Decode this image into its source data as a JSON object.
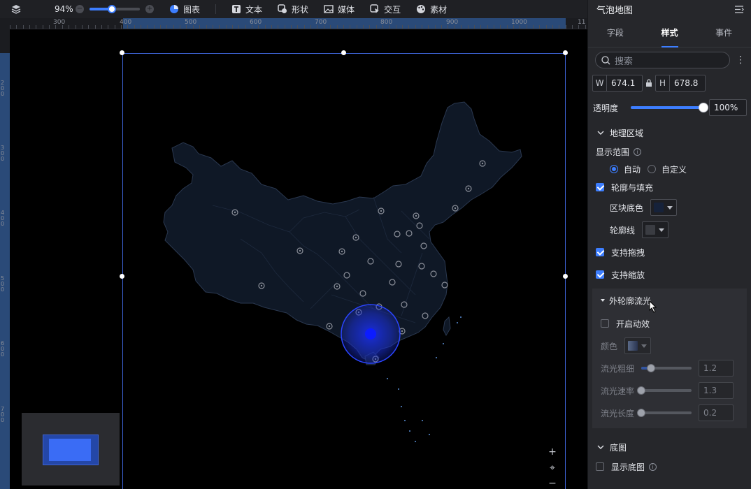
{
  "toolbar": {
    "zoom": "94%",
    "zoom_fraction": 0.45,
    "items": [
      {
        "label": "图表",
        "icon": "chart-pie-icon"
      },
      {
        "label": "文本",
        "icon": "text-icon"
      },
      {
        "label": "形状",
        "icon": "shape-icon"
      },
      {
        "label": "媒体",
        "icon": "image-icon"
      },
      {
        "label": "交互",
        "icon": "interaction-icon"
      },
      {
        "label": "素材",
        "icon": "palette-icon"
      }
    ]
  },
  "ruler": {
    "h_labels": [
      "300",
      "400",
      "500",
      "600",
      "700",
      "800",
      "900",
      "1000",
      "11"
    ],
    "v_labels": [
      "2\n0\n0",
      "3\n0\n0",
      "4\n0\n0",
      "5\n0\n0",
      "6\n0\n0",
      "7\n0\n0"
    ]
  },
  "map_ctrl": {
    "zoom_in": "+",
    "locate": "⌖",
    "zoom_out": "−"
  },
  "panel": {
    "title": "气泡地图",
    "tabs": [
      "字段",
      "样式",
      "事件"
    ],
    "active_tab": "样式",
    "search_placeholder": "搜索",
    "kebab": "⋮",
    "w_label": "W",
    "w_value": "674.1",
    "h_label": "H",
    "h_value": "678.8",
    "opacity_label": "透明度",
    "opacity_value": "100%",
    "opacity_fraction": 1.0,
    "geo_section": "地理区域",
    "display_range": "显示范围",
    "info_glyph": "i",
    "radio_auto": "自动",
    "radio_custom": "自定义",
    "outline_fill": "轮廓与填充",
    "block_color_label": "区块底色",
    "block_color": "#16223a",
    "outline_label": "轮廓线",
    "outline_color": "#3a3c42",
    "drag": "支持拖拽",
    "zoom": "支持缩放",
    "flow_section": "外轮廓流光",
    "enable_anim": "开启动效",
    "color_label": "颜色",
    "flow_width_label": "流光粗细",
    "flow_width": "1.2",
    "flow_width_fraction": 0.2,
    "flow_speed_label": "流光速率",
    "flow_speed": "1.3",
    "flow_speed_fraction": 0.0,
    "flow_length_label": "流光长度",
    "flow_length": "0.2",
    "flow_length_fraction": 0.0,
    "base_section": "底图",
    "show_base": "显示底图"
  },
  "colors": {
    "accent": "#3d7eff",
    "panel_bg": "#26272b",
    "map_fill": "#0f1826",
    "map_stroke": "#2a3850"
  }
}
